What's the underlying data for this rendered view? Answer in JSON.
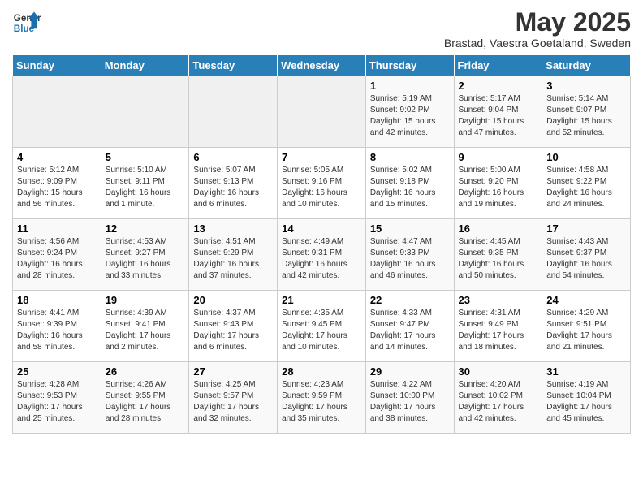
{
  "header": {
    "logo_line1": "General",
    "logo_line2": "Blue",
    "month": "May 2025",
    "location": "Brastad, Vaestra Goetaland, Sweden"
  },
  "days_of_week": [
    "Sunday",
    "Monday",
    "Tuesday",
    "Wednesday",
    "Thursday",
    "Friday",
    "Saturday"
  ],
  "weeks": [
    [
      {
        "day": "",
        "info": ""
      },
      {
        "day": "",
        "info": ""
      },
      {
        "day": "",
        "info": ""
      },
      {
        "day": "",
        "info": ""
      },
      {
        "day": "1",
        "info": "Sunrise: 5:19 AM\nSunset: 9:02 PM\nDaylight: 15 hours\nand 42 minutes."
      },
      {
        "day": "2",
        "info": "Sunrise: 5:17 AM\nSunset: 9:04 PM\nDaylight: 15 hours\nand 47 minutes."
      },
      {
        "day": "3",
        "info": "Sunrise: 5:14 AM\nSunset: 9:07 PM\nDaylight: 15 hours\nand 52 minutes."
      }
    ],
    [
      {
        "day": "4",
        "info": "Sunrise: 5:12 AM\nSunset: 9:09 PM\nDaylight: 15 hours\nand 56 minutes."
      },
      {
        "day": "5",
        "info": "Sunrise: 5:10 AM\nSunset: 9:11 PM\nDaylight: 16 hours\nand 1 minute."
      },
      {
        "day": "6",
        "info": "Sunrise: 5:07 AM\nSunset: 9:13 PM\nDaylight: 16 hours\nand 6 minutes."
      },
      {
        "day": "7",
        "info": "Sunrise: 5:05 AM\nSunset: 9:16 PM\nDaylight: 16 hours\nand 10 minutes."
      },
      {
        "day": "8",
        "info": "Sunrise: 5:02 AM\nSunset: 9:18 PM\nDaylight: 16 hours\nand 15 minutes."
      },
      {
        "day": "9",
        "info": "Sunrise: 5:00 AM\nSunset: 9:20 PM\nDaylight: 16 hours\nand 19 minutes."
      },
      {
        "day": "10",
        "info": "Sunrise: 4:58 AM\nSunset: 9:22 PM\nDaylight: 16 hours\nand 24 minutes."
      }
    ],
    [
      {
        "day": "11",
        "info": "Sunrise: 4:56 AM\nSunset: 9:24 PM\nDaylight: 16 hours\nand 28 minutes."
      },
      {
        "day": "12",
        "info": "Sunrise: 4:53 AM\nSunset: 9:27 PM\nDaylight: 16 hours\nand 33 minutes."
      },
      {
        "day": "13",
        "info": "Sunrise: 4:51 AM\nSunset: 9:29 PM\nDaylight: 16 hours\nand 37 minutes."
      },
      {
        "day": "14",
        "info": "Sunrise: 4:49 AM\nSunset: 9:31 PM\nDaylight: 16 hours\nand 42 minutes."
      },
      {
        "day": "15",
        "info": "Sunrise: 4:47 AM\nSunset: 9:33 PM\nDaylight: 16 hours\nand 46 minutes."
      },
      {
        "day": "16",
        "info": "Sunrise: 4:45 AM\nSunset: 9:35 PM\nDaylight: 16 hours\nand 50 minutes."
      },
      {
        "day": "17",
        "info": "Sunrise: 4:43 AM\nSunset: 9:37 PM\nDaylight: 16 hours\nand 54 minutes."
      }
    ],
    [
      {
        "day": "18",
        "info": "Sunrise: 4:41 AM\nSunset: 9:39 PM\nDaylight: 16 hours\nand 58 minutes."
      },
      {
        "day": "19",
        "info": "Sunrise: 4:39 AM\nSunset: 9:41 PM\nDaylight: 17 hours\nand 2 minutes."
      },
      {
        "day": "20",
        "info": "Sunrise: 4:37 AM\nSunset: 9:43 PM\nDaylight: 17 hours\nand 6 minutes."
      },
      {
        "day": "21",
        "info": "Sunrise: 4:35 AM\nSunset: 9:45 PM\nDaylight: 17 hours\nand 10 minutes."
      },
      {
        "day": "22",
        "info": "Sunrise: 4:33 AM\nSunset: 9:47 PM\nDaylight: 17 hours\nand 14 minutes."
      },
      {
        "day": "23",
        "info": "Sunrise: 4:31 AM\nSunset: 9:49 PM\nDaylight: 17 hours\nand 18 minutes."
      },
      {
        "day": "24",
        "info": "Sunrise: 4:29 AM\nSunset: 9:51 PM\nDaylight: 17 hours\nand 21 minutes."
      }
    ],
    [
      {
        "day": "25",
        "info": "Sunrise: 4:28 AM\nSunset: 9:53 PM\nDaylight: 17 hours\nand 25 minutes."
      },
      {
        "day": "26",
        "info": "Sunrise: 4:26 AM\nSunset: 9:55 PM\nDaylight: 17 hours\nand 28 minutes."
      },
      {
        "day": "27",
        "info": "Sunrise: 4:25 AM\nSunset: 9:57 PM\nDaylight: 17 hours\nand 32 minutes."
      },
      {
        "day": "28",
        "info": "Sunrise: 4:23 AM\nSunset: 9:59 PM\nDaylight: 17 hours\nand 35 minutes."
      },
      {
        "day": "29",
        "info": "Sunrise: 4:22 AM\nSunset: 10:00 PM\nDaylight: 17 hours\nand 38 minutes."
      },
      {
        "day": "30",
        "info": "Sunrise: 4:20 AM\nSunset: 10:02 PM\nDaylight: 17 hours\nand 42 minutes."
      },
      {
        "day": "31",
        "info": "Sunrise: 4:19 AM\nSunset: 10:04 PM\nDaylight: 17 hours\nand 45 minutes."
      }
    ]
  ]
}
